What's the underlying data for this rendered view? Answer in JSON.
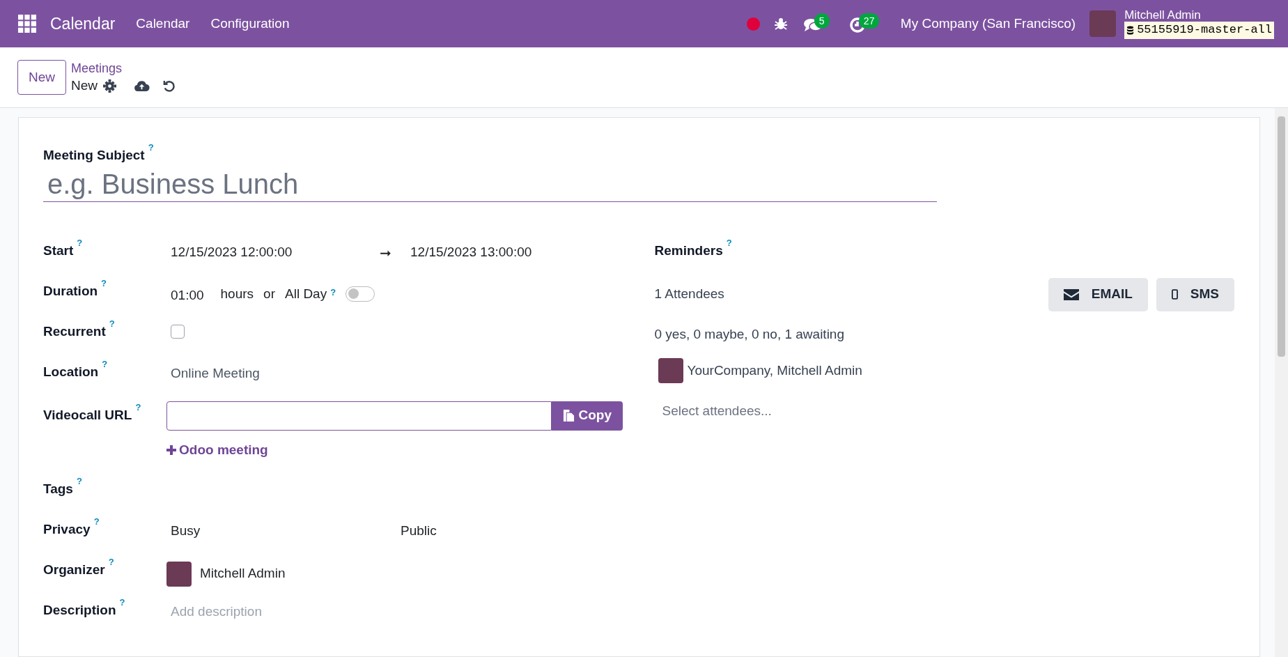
{
  "navbar": {
    "app_name": "Calendar",
    "menus": [
      "Calendar",
      "Configuration"
    ],
    "recording": true,
    "messages_count": "5",
    "activities_count": "27",
    "company": "My Company (San Francisco)",
    "user": "Mitchell Admin",
    "database": "55155919-master-all"
  },
  "control_panel": {
    "new_button": "New",
    "breadcrumb_parent": "Meetings",
    "breadcrumb_current": "New"
  },
  "form": {
    "subject": {
      "label": "Meeting Subject",
      "help": "?",
      "placeholder": "e.g. Business Lunch"
    },
    "fields": [
      {
        "kind": "daterange",
        "label": "Start",
        "help": "?",
        "start": "12/15/2023 12:00:00",
        "arrow": "➞",
        "end": "12/15/2023 13:00:00"
      },
      {
        "kind": "duration",
        "label": "Duration",
        "help": "?",
        "value": "01:00",
        "unit": "hours",
        "or": "or",
        "allday_label": "All Day",
        "allday_help": "?",
        "allday_on": false
      },
      {
        "kind": "checkbox",
        "label": "Recurrent",
        "help": "?",
        "checked": false
      },
      {
        "kind": "text",
        "label": "Location",
        "help": "?",
        "value": "Online Meeting"
      },
      {
        "kind": "url",
        "label": "Videocall URL",
        "help": "?",
        "copy_button": "Copy",
        "link": "Odoo meeting"
      },
      {
        "kind": "empty",
        "label": "Tags",
        "help": "?"
      },
      {
        "kind": "pair",
        "label": "Privacy",
        "help": "?",
        "value": "Busy",
        "value2": "Public"
      },
      {
        "kind": "user",
        "label": "Organizer",
        "help": "?",
        "value": "Mitchell Admin"
      },
      {
        "kind": "placeholder",
        "label": "Description",
        "help": "?",
        "placeholder": "Add description"
      }
    ],
    "reminders": {
      "label": "Reminders",
      "help": "?"
    },
    "attendees_count": "1 Attendees",
    "buttons": [
      {
        "kind": "email",
        "label": "EMAIL"
      },
      {
        "kind": "sms",
        "label": "SMS"
      }
    ],
    "attendance_summary": "0 yes, 0 maybe, 0 no, 1 awaiting",
    "attendees": [
      "YourCompany, Mitchell Admin"
    ],
    "attendee_placeholder": "Select attendees..."
  }
}
